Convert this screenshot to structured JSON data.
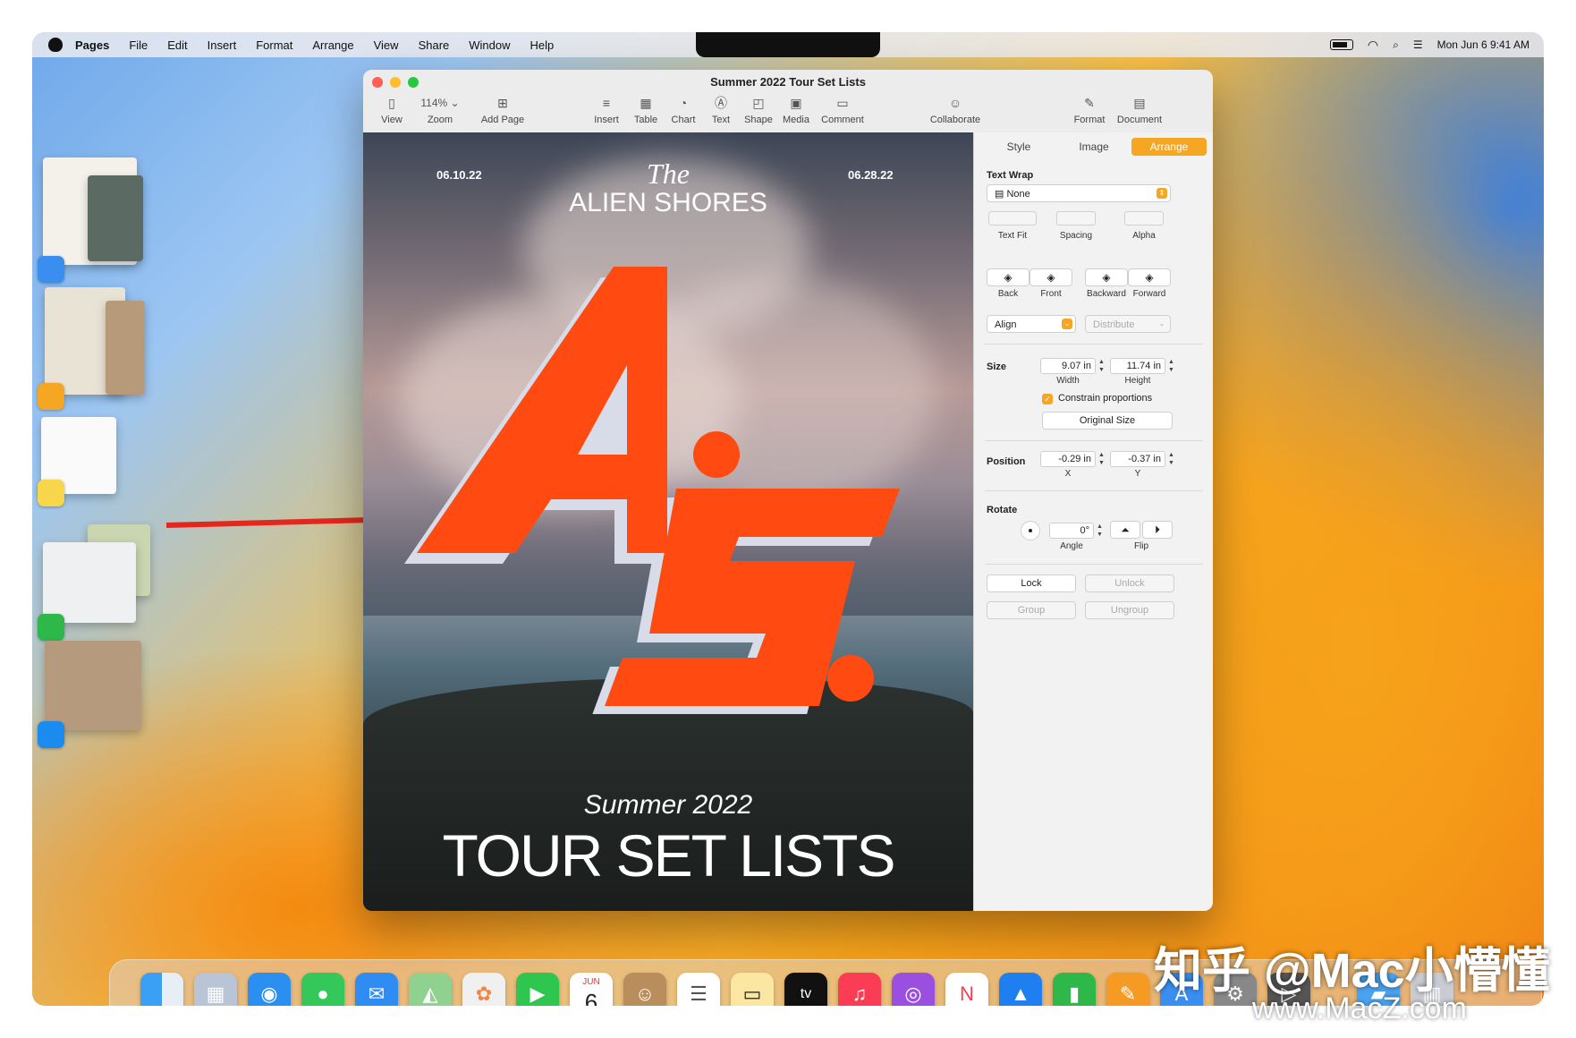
{
  "menubar": {
    "app": "Pages",
    "items": [
      "File",
      "Edit",
      "Insert",
      "Format",
      "Arrange",
      "View",
      "Share",
      "Window",
      "Help"
    ],
    "clock": "Mon Jun 6  9:41 AM"
  },
  "window": {
    "title": "Summer 2022 Tour Set Lists",
    "toolbar": {
      "view": "View",
      "zoom_value": "114%",
      "zoom": "Zoom",
      "add_page": "Add Page",
      "insert": "Insert",
      "table": "Table",
      "chart": "Chart",
      "text": "Text",
      "shape": "Shape",
      "media": "Media",
      "comment": "Comment",
      "collaborate": "Collaborate",
      "format": "Format",
      "document": "Document"
    }
  },
  "poster": {
    "date_left": "06.10.22",
    "date_right": "06.28.22",
    "the": "The",
    "band": "ALIEN SHORES",
    "summer": "Summer 2022",
    "tour": "TOUR SET LISTS",
    "art_color": "#ff4a12"
  },
  "inspector": {
    "tabs": [
      "Style",
      "Image",
      "Arrange"
    ],
    "active_tab": "Arrange",
    "text_wrap": {
      "label": "Text Wrap",
      "value": "None",
      "text_fit": "Text Fit",
      "spacing": "Spacing",
      "alpha": "Alpha"
    },
    "layer": {
      "back": "Back",
      "front": "Front",
      "backward": "Backward",
      "forward": "Forward"
    },
    "align": "Align",
    "distribute": "Distribute",
    "size": {
      "label": "Size",
      "width": "9.07 in",
      "height": "11.74 in",
      "width_label": "Width",
      "height_label": "Height",
      "constrain": "Constrain proportions",
      "original": "Original Size"
    },
    "position": {
      "label": "Position",
      "x": "-0.29 in",
      "y": "-0.37 in",
      "x_label": "X",
      "y_label": "Y"
    },
    "rotate": {
      "label": "Rotate",
      "angle": "0°",
      "angle_label": "Angle",
      "flip_label": "Flip"
    },
    "lock": "Lock",
    "unlock": "Unlock",
    "group": "Group",
    "ungroup": "Ungroup",
    "accent": "#f5a623"
  },
  "dock": {
    "calendar_month": "JUN",
    "calendar_day": "6",
    "tv": "tv"
  },
  "watermark": {
    "line1": "知乎 @Mac小懵懂",
    "line2": "www.MacZ.com"
  }
}
